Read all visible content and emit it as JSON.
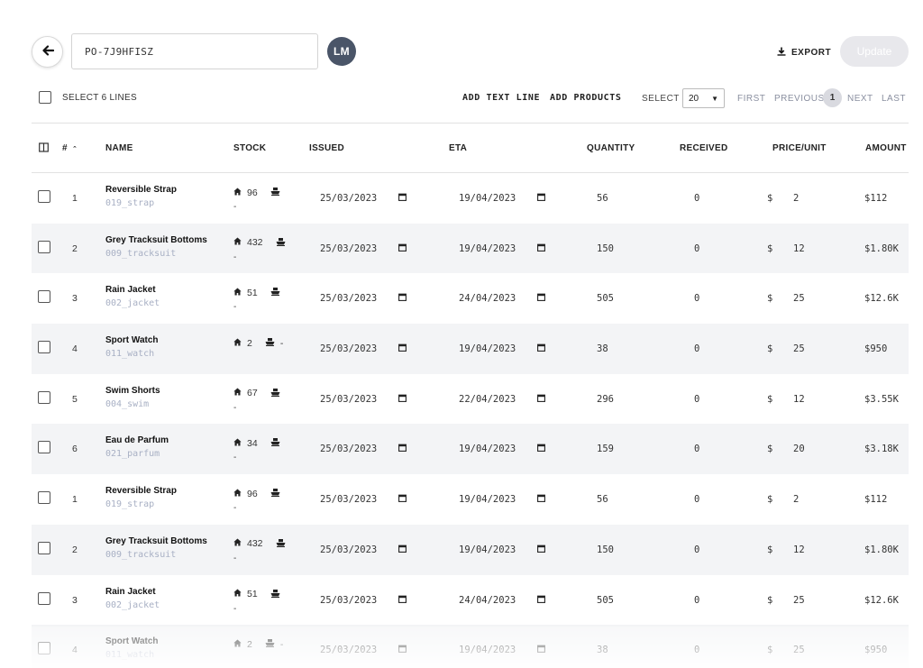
{
  "header": {
    "po_number": "PO-7J9HFISZ",
    "avatar_initials": "LM",
    "export_label": "EXPORT",
    "update_label": "Update"
  },
  "toolbar": {
    "select_lines_label": "SELECT 6 LINES",
    "add_text_line_label": "ADD TEXT LINE",
    "add_products_label": "ADD PRODUCTS",
    "select_label": "SELECT",
    "page_size": "20",
    "first_label": "FIRST",
    "previous_label": "PREVIOUS",
    "current_page": "1",
    "next_label": "NEXT",
    "last_label": "LAST"
  },
  "table": {
    "columns": {
      "index": "#",
      "name": "NAME",
      "stock": "STOCK",
      "issued": "ISSUED",
      "eta": "ETA",
      "quantity": "QUANTITY",
      "received": "RECEIVED",
      "price_unit": "PRICE/UNIT",
      "amount": "AMOUNT"
    },
    "rows": [
      {
        "idx": "1",
        "name": "Reversible Strap",
        "sku": "019_strap",
        "stock": "96",
        "incoming": "",
        "dash": "-",
        "issued": "25/03/2023",
        "eta": "19/04/2023",
        "quantity": "56",
        "received": "0",
        "currency": "$",
        "price": "2",
        "amount": "$112"
      },
      {
        "idx": "2",
        "name": "Grey Tracksuit Bottoms",
        "sku": "009_tracksuit",
        "stock": "432",
        "incoming": "",
        "dash": "-",
        "issued": "25/03/2023",
        "eta": "19/04/2023",
        "quantity": "150",
        "received": "0",
        "currency": "$",
        "price": "12",
        "amount": "$1.80K"
      },
      {
        "idx": "3",
        "name": "Rain Jacket",
        "sku": "002_jacket",
        "stock": "51",
        "incoming": "",
        "dash": "-",
        "issued": "25/03/2023",
        "eta": "24/04/2023",
        "quantity": "505",
        "received": "0",
        "currency": "$",
        "price": "25",
        "amount": "$12.6K"
      },
      {
        "idx": "4",
        "name": "Sport Watch",
        "sku": "011_watch",
        "stock": "2",
        "incoming": "-",
        "dash": "",
        "issued": "25/03/2023",
        "eta": "19/04/2023",
        "quantity": "38",
        "received": "0",
        "currency": "$",
        "price": "25",
        "amount": "$950"
      },
      {
        "idx": "5",
        "name": "Swim Shorts",
        "sku": "004_swim",
        "stock": "67",
        "incoming": "",
        "dash": "-",
        "issued": "25/03/2023",
        "eta": "22/04/2023",
        "quantity": "296",
        "received": "0",
        "currency": "$",
        "price": "12",
        "amount": "$3.55K"
      },
      {
        "idx": "6",
        "name": "Eau de Parfum",
        "sku": "021_parfum",
        "stock": "34",
        "incoming": "",
        "dash": "-",
        "issued": "25/03/2023",
        "eta": "19/04/2023",
        "quantity": "159",
        "received": "0",
        "currency": "$",
        "price": "20",
        "amount": "$3.18K"
      },
      {
        "idx": "1",
        "name": "Reversible Strap",
        "sku": "019_strap",
        "stock": "96",
        "incoming": "",
        "dash": "-",
        "issued": "25/03/2023",
        "eta": "19/04/2023",
        "quantity": "56",
        "received": "0",
        "currency": "$",
        "price": "2",
        "amount": "$112"
      },
      {
        "idx": "2",
        "name": "Grey Tracksuit Bottoms",
        "sku": "009_tracksuit",
        "stock": "432",
        "incoming": "",
        "dash": "-",
        "issued": "25/03/2023",
        "eta": "19/04/2023",
        "quantity": "150",
        "received": "0",
        "currency": "$",
        "price": "12",
        "amount": "$1.80K"
      },
      {
        "idx": "3",
        "name": "Rain Jacket",
        "sku": "002_jacket",
        "stock": "51",
        "incoming": "",
        "dash": "-",
        "issued": "25/03/2023",
        "eta": "24/04/2023",
        "quantity": "505",
        "received": "0",
        "currency": "$",
        "price": "25",
        "amount": "$12.6K"
      },
      {
        "idx": "4",
        "name": "Sport Watch",
        "sku": "011_watch",
        "stock": "2",
        "incoming": "-",
        "dash": "",
        "issued": "25/03/2023",
        "eta": "19/04/2023",
        "quantity": "38",
        "received": "0",
        "currency": "$",
        "price": "25",
        "amount": "$950"
      }
    ]
  }
}
